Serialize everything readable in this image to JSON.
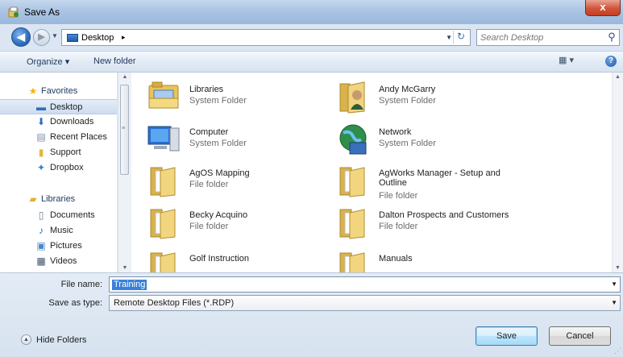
{
  "window": {
    "title": "Save As",
    "close_glyph": "x"
  },
  "address": {
    "location": "Desktop",
    "chevron": "▸",
    "dropdown_glyph": "▼",
    "refresh_glyph": "↻"
  },
  "search": {
    "placeholder": "Search Desktop"
  },
  "commandbar": {
    "organize": "Organize ▾",
    "new_folder": "New folder",
    "views_glyph": "▦ ▾",
    "help_glyph": "?"
  },
  "nav": {
    "items": [
      {
        "label": "Favorites",
        "icon": "star-icon",
        "glyph": "★",
        "color": "#f2b31b",
        "heading": true
      },
      {
        "label": "Desktop",
        "icon": "desktop-icon",
        "glyph": "▬",
        "color": "#2f6cc0",
        "selected": true
      },
      {
        "label": "Downloads",
        "icon": "downloads-folder-icon",
        "glyph": "⬇",
        "color": "#2a6bc9"
      },
      {
        "label": "Recent Places",
        "icon": "recent-places-icon",
        "glyph": "▤",
        "color": "#7d8ea6"
      },
      {
        "label": "Support",
        "icon": "folder-icon",
        "glyph": "▮",
        "color": "#e2b740"
      },
      {
        "label": "Dropbox",
        "icon": "dropbox-icon",
        "glyph": "✦",
        "color": "#3a7fd0"
      },
      {
        "label": "Libraries",
        "icon": "libraries-icon",
        "glyph": "▰",
        "color": "#e0b23c",
        "heading": true
      },
      {
        "label": "Documents",
        "icon": "documents-icon",
        "glyph": "▯",
        "color": "#6a7f9a"
      },
      {
        "label": "Music",
        "icon": "music-icon",
        "glyph": "♪",
        "color": "#2a6bc9"
      },
      {
        "label": "Pictures",
        "icon": "pictures-icon",
        "glyph": "▣",
        "color": "#4a86c7"
      },
      {
        "label": "Videos",
        "icon": "videos-icon",
        "glyph": "▦",
        "color": "#3d4f69"
      }
    ]
  },
  "files": [
    {
      "name": "Libraries",
      "type": "System Folder",
      "icon": "libraries-folder-icon"
    },
    {
      "name": "Andy McGarry",
      "type": "System Folder",
      "icon": "user-folder-icon"
    },
    {
      "name": "Computer",
      "type": "System Folder",
      "icon": "computer-icon"
    },
    {
      "name": "Network",
      "type": "System Folder",
      "icon": "network-icon"
    },
    {
      "name": "AgOS Mapping",
      "type": "File folder",
      "icon": "folder-icon"
    },
    {
      "name": "AgWorks Manager - Setup and Outline",
      "type": "File folder",
      "icon": "folder-icon"
    },
    {
      "name": "Becky Acquino",
      "type": "File folder",
      "icon": "folder-icon"
    },
    {
      "name": "Dalton Prospects and Customers",
      "type": "File folder",
      "icon": "folder-icon"
    },
    {
      "name": "Golf Instruction",
      "type": "",
      "icon": "folder-icon"
    },
    {
      "name": "Manuals",
      "type": "",
      "icon": "folder-icon"
    }
  ],
  "form": {
    "file_name_label": "File name:",
    "file_name_value": "Training",
    "save_type_label": "Save as type:",
    "save_type_value": "Remote Desktop Files (*.RDP)",
    "hide_folders": "Hide Folders",
    "save": "Save",
    "cancel": "Cancel"
  }
}
